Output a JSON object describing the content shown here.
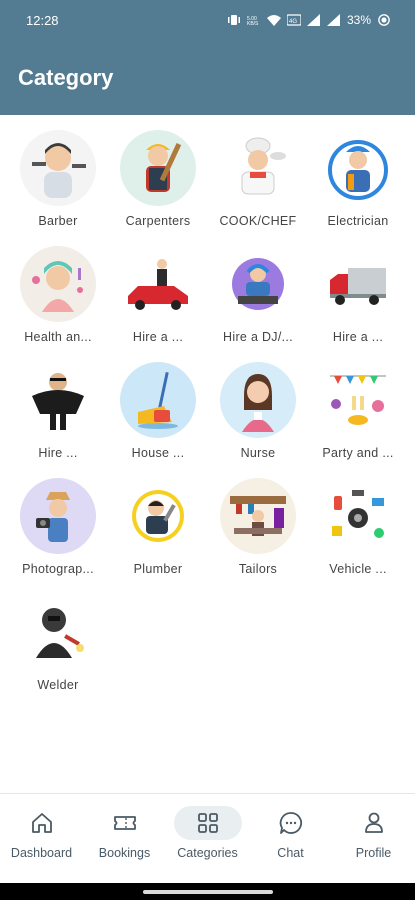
{
  "status_bar": {
    "time": "12:28",
    "battery": "33%"
  },
  "header": {
    "title": "Category"
  },
  "categories": [
    {
      "label": "Barber",
      "icon": "barber-icon",
      "bg": "#f4f4f4"
    },
    {
      "label": "Carpenters",
      "icon": "carpenter-icon",
      "bg": "#dff0ea"
    },
    {
      "label": "COOK/CHEF",
      "icon": "chef-icon",
      "bg": "#ffffff"
    },
    {
      "label": "Electrician",
      "icon": "electrician-icon",
      "bg": "#ffffff"
    },
    {
      "label": "Health an...",
      "icon": "health-beauty-icon",
      "bg": "#f3ede8"
    },
    {
      "label": "Hire a ...",
      "icon": "car-driver-icon",
      "bg": "#ffffff"
    },
    {
      "label": "Hire a DJ/...",
      "icon": "dj-icon",
      "bg": "#ffffff"
    },
    {
      "label": "Hire a ...",
      "icon": "truck-icon",
      "bg": "#ffffff"
    },
    {
      "label": "Hire ...",
      "icon": "bodyguard-icon",
      "bg": "#ffffff"
    },
    {
      "label": "House ...",
      "icon": "house-cleaning-icon",
      "bg": "#cce7f7"
    },
    {
      "label": "Nurse",
      "icon": "nurse-icon",
      "bg": "#d6ecf8"
    },
    {
      "label": "Party and ...",
      "icon": "party-icon",
      "bg": "#ffffff"
    },
    {
      "label": "Photograp...",
      "icon": "photographer-icon",
      "bg": "#ded9f4"
    },
    {
      "label": "Plumber",
      "icon": "plumber-icon",
      "bg": "#ffffff"
    },
    {
      "label": "Tailors",
      "icon": "tailor-icon",
      "bg": "#f6efe4"
    },
    {
      "label": "Vehicle ...",
      "icon": "vehicle-parts-icon",
      "bg": "#ffffff"
    },
    {
      "label": "Welder",
      "icon": "welder-icon",
      "bg": "#ffffff"
    }
  ],
  "bottom_nav": [
    {
      "label": "Dashboard",
      "icon": "home-icon",
      "active": false
    },
    {
      "label": "Bookings",
      "icon": "ticket-icon",
      "active": false
    },
    {
      "label": "Categories",
      "icon": "grid-icon",
      "active": true
    },
    {
      "label": "Chat",
      "icon": "chat-icon",
      "active": false
    },
    {
      "label": "Profile",
      "icon": "person-icon",
      "active": false
    }
  ],
  "colors": {
    "primary": "#537b92",
    "active_nav_bg": "#e9eef1",
    "nav_text": "#4a5a66"
  }
}
